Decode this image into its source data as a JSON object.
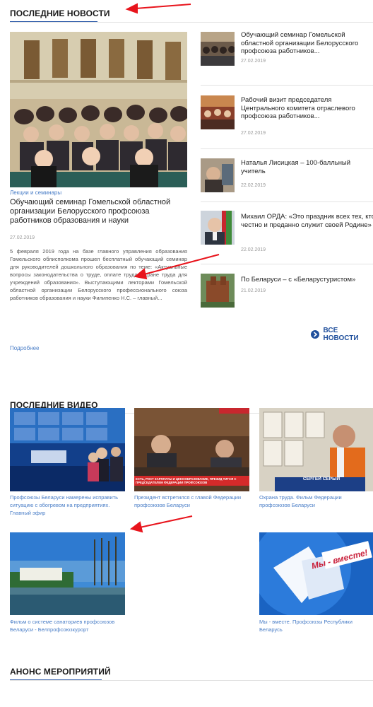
{
  "news_section": {
    "title": "ПОСЛЕДНИЕ НОВОСТИ",
    "main": {
      "category": "Лекции и семинары",
      "title": "Обучающий семинар Гомельской областной организации Белорусского профсоюза работников образования  и науки",
      "date": "27.02.2019",
      "excerpt": "5 февраля 2019 года на базе главного управления образования Гомельского облисполкома прошел бесплатный обучающий семинар для руководителей дошкольного образования по теме: «Актуальные вопросы законодательства о труде, оплате труда, охране труда для учреждений образования». Выступающими лекторами Гомельской областной организации Белорусского профессионального союза работников образования и науки Филипенко Н.С. – главный...",
      "more": "Подробнее"
    },
    "items": [
      {
        "title": "Обучающий семинар Гомельской областной организации Белорусского профсоюза работников...",
        "date": "27.02.2019"
      },
      {
        "title": "Рабочий визит председателя Центрального комитета отраслевого профсоюза работников...",
        "date": "27.02.2019"
      },
      {
        "title": "Наталья Лисицкая – 100-балльный учитель",
        "date": "22.02.2019"
      },
      {
        "title": "Михаил ОРДА: «Это праздник всех тех, кто честно и преданно служит своей Родине»",
        "date": "22.02.2019"
      },
      {
        "title": "По Беларуси – с «Беларустуристом»",
        "date": "21.02.2019"
      }
    ],
    "all_news": "ВСЕ НОВОСТИ"
  },
  "video_section": {
    "title": "ПОСЛЕДНИЕ ВИДЕО",
    "videos": [
      {
        "caption": "Профсоюзы Беларуси намерены исправить ситуацию с обогревом на предприятиях. Главный эфир"
      },
      {
        "caption": "Президент встретился с главой Федерации профсоюзов Беларуси",
        "ticker": "ЕСТЬ, РОСТ ЗАРПЛАТЫ И ЦЕНООБРАЗОВАНИЕ, ПРЕЗИД ТИТСЯ С ПРЕДСЕДАТЕЛЕМ ФЕДЕРАЦИИ ПРОФСОЮЗОВ"
      },
      {
        "caption": "Охрана труда. Фильм Федерации профсоюзов Беларуси",
        "nameplate": "СЕРГЕЙ СЕРЫЙ"
      },
      {
        "caption": "Фильм о системе санаториев профсоюзов Беларуси - Белпрофсоюзкурорт"
      },
      {
        "caption": "Мы - вместе. Профсоюзы Республики Беларусь",
        "logo_text": "Мы - вместе!"
      }
    ]
  },
  "events_section": {
    "title": "АНОНС МЕРОПРИЯТИЙ"
  },
  "colors": {
    "accent": "#2d5aa8",
    "link": "#4a7ec7",
    "arrow": "#e8141c"
  }
}
